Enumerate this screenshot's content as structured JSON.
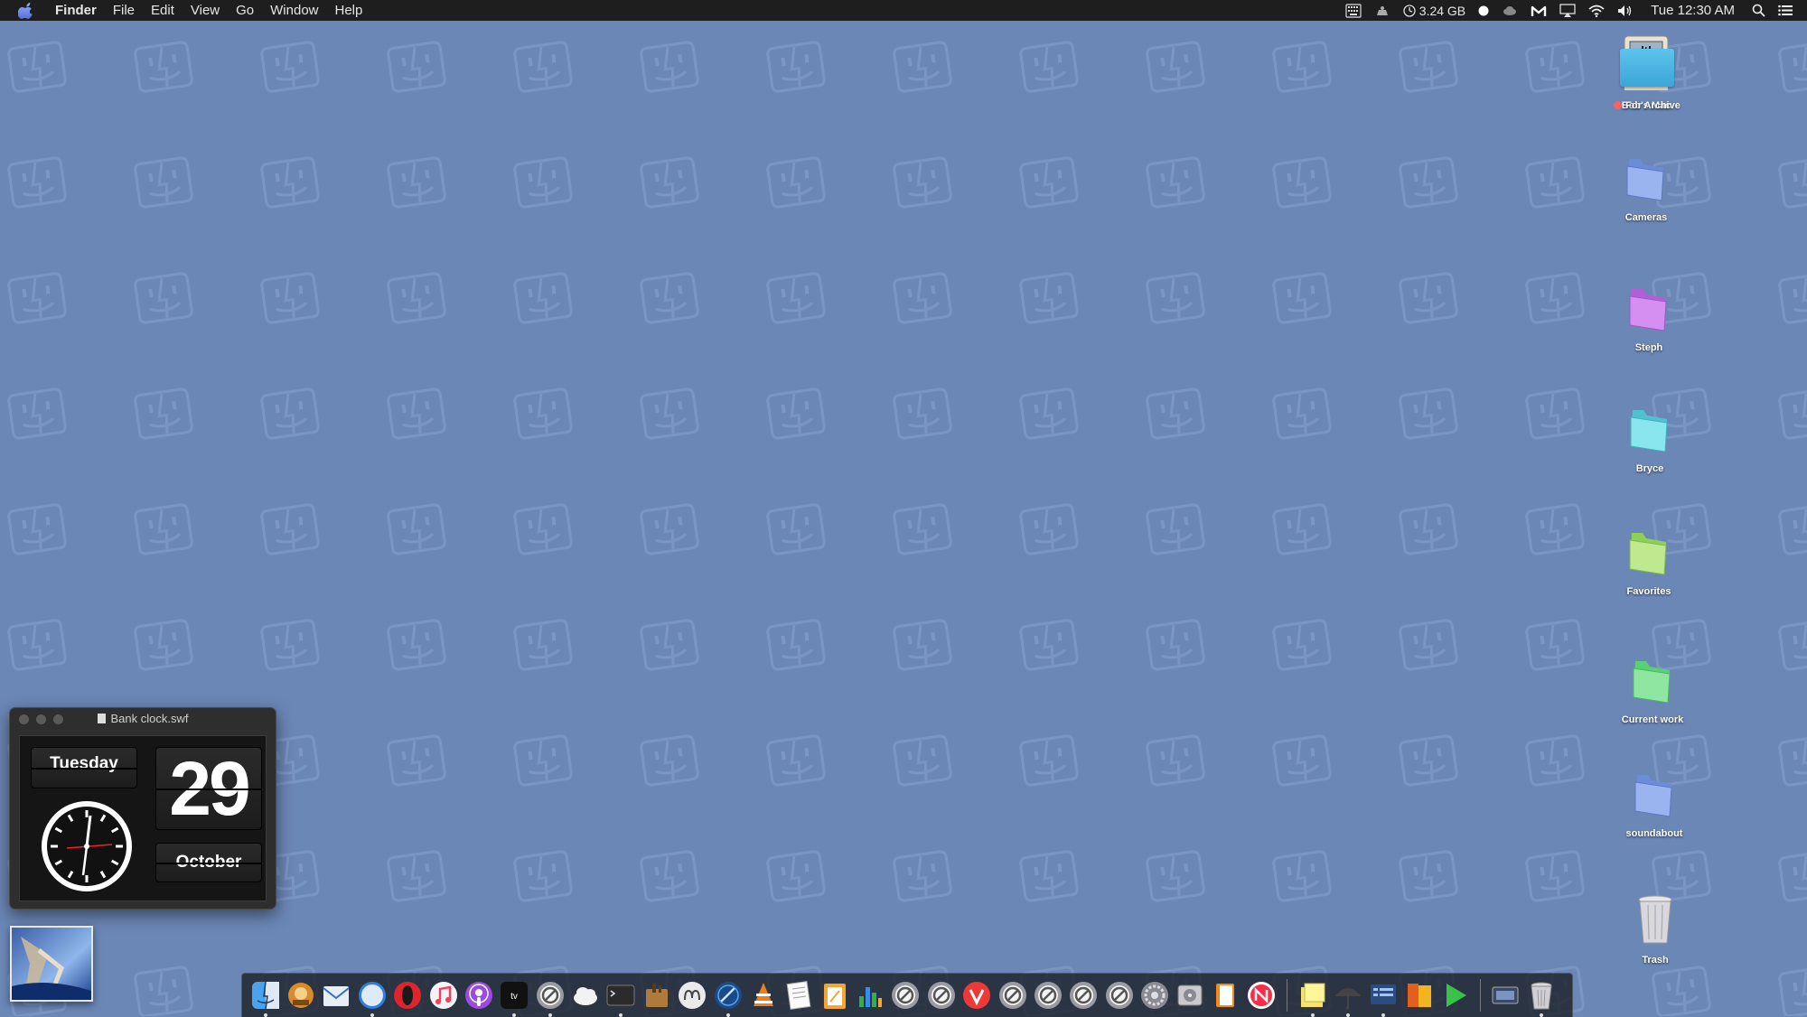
{
  "menubar": {
    "apple": "apple-menu",
    "app_name": "Finder",
    "menus": [
      "File",
      "Edit",
      "View",
      "Go",
      "Window",
      "Help"
    ],
    "status": {
      "memory": "3.24 GB",
      "clock": "Tue 12:30 AM"
    }
  },
  "desktop": {
    "icons": [
      {
        "label": "Bob's Mac"
      },
      {
        "label": "For Archive",
        "tag_color": "#ff6161"
      },
      {
        "label": "Cameras"
      },
      {
        "label": "Steph"
      },
      {
        "label": "Bryce"
      },
      {
        "label": "Favorites"
      },
      {
        "label": "Current work"
      },
      {
        "label": "soundabout"
      },
      {
        "label": "Trash"
      }
    ]
  },
  "clock_widget": {
    "window_title": "Bank clock.swf",
    "day": "Tuesday",
    "date": "29",
    "month": "October"
  },
  "dock": {
    "apps": [
      "finder",
      "fetch",
      "mail",
      "safari",
      "opera",
      "music",
      "podcasts",
      "apple-tv",
      "blocked-app",
      "icloud",
      "terminal",
      "utility-app",
      "mindnode",
      "pixelmator",
      "vlc",
      "textedit",
      "pages",
      "numbers",
      "blocked-app",
      "blocked-app",
      "vivaldi",
      "blocked-app",
      "blocked-app",
      "blocked-app",
      "blocked-app",
      "system-preferences",
      "disk-utility",
      "books",
      "news",
      "stickies",
      "umbrella-app",
      "screen-app",
      "office-app",
      "play-app",
      "screenshot-app",
      "trash"
    ]
  },
  "colors": {
    "desktop": "#6b87b6",
    "menubar": "#1e1e1e"
  }
}
